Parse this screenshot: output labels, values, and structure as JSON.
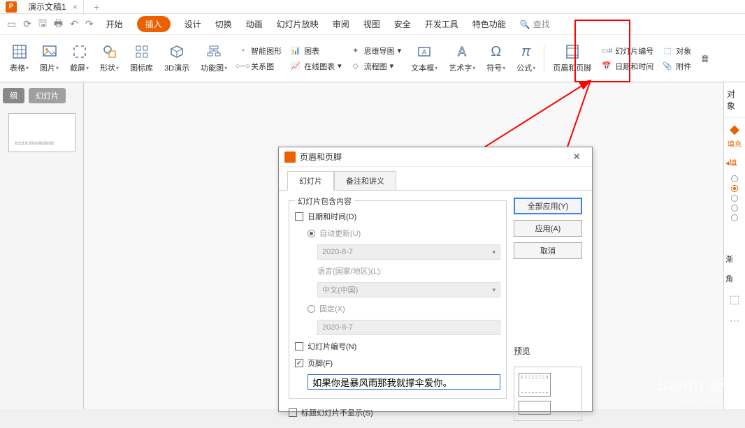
{
  "titlebar": {
    "app_name": "演示文稿1"
  },
  "qat": {
    "items": [
      "new",
      "open",
      "save",
      "print",
      "undo",
      "redo"
    ]
  },
  "menu": {
    "items": [
      "开始",
      "插入",
      "设计",
      "切换",
      "动画",
      "幻灯片放映",
      "审阅",
      "视图",
      "安全",
      "开发工具",
      "特色功能"
    ],
    "active": 1,
    "search": "查找"
  },
  "ribbon": {
    "big": [
      {
        "label": "表格",
        "icon": "table"
      },
      {
        "label": "图片",
        "icon": "picture"
      },
      {
        "label": "截屏",
        "icon": "screenshot"
      },
      {
        "label": "形状",
        "icon": "shapes"
      },
      {
        "label": "图标库",
        "icon": "iconlib"
      },
      {
        "label": "3D演示",
        "icon": "3d"
      },
      {
        "label": "功能图",
        "icon": "funcchart"
      }
    ],
    "col1": [
      {
        "label": "智能图形",
        "icon": "smartart"
      },
      {
        "label": "关系图",
        "icon": "relation"
      }
    ],
    "col2": [
      {
        "label": "图表",
        "icon": "chart"
      },
      {
        "label": "在线图表",
        "icon": "onlinechart"
      }
    ],
    "col3": [
      {
        "label": "思维导图",
        "icon": "mindmap"
      },
      {
        "label": "流程图",
        "icon": "flowchart"
      }
    ],
    "big2": [
      {
        "label": "文本框",
        "icon": "textbox"
      },
      {
        "label": "艺术字",
        "icon": "wordart"
      },
      {
        "label": "符号",
        "icon": "symbol"
      },
      {
        "label": "公式",
        "icon": "equation"
      },
      {
        "label": "页眉和页脚",
        "icon": "headerfooter"
      }
    ],
    "col4": [
      {
        "label": "幻灯片编号",
        "icon": "slidenum"
      },
      {
        "label": "日期和时间",
        "icon": "datetime"
      }
    ],
    "col5": [
      {
        "label": "对象",
        "icon": "object"
      },
      {
        "label": "附件",
        "icon": "attach"
      }
    ],
    "audio": "音"
  },
  "thumb": {
    "tabs": [
      "纲",
      "幻灯片"
    ],
    "active": 1,
    "content": "单击此处添加标题/副标题"
  },
  "sidepanel": {
    "title": "对象",
    "fill": "填充",
    "section": "填",
    "grad": "渐",
    "corner": "角"
  },
  "dialog": {
    "title": "页眉和页脚",
    "tabs": [
      "幻灯片",
      "备注和讲义"
    ],
    "active_tab": 0,
    "group_title": "幻灯片包含内容",
    "date_label": "日期和时间(D)",
    "auto_update": "自动更新(U)",
    "date_value": "2020-8-7",
    "lang_label": "语言(国家/地区)(L):",
    "lang_value": "中文(中国)",
    "fixed_label": "固定(X)",
    "fixed_value": "2020-8-7",
    "slidenum_label": "幻灯片编号(N)",
    "footer_label": "页脚(F)",
    "footer_value": "如果你是暴风雨那我就撑伞爱你。",
    "hide_title": "标题幻灯片不显示(S)",
    "btn_apply_all": "全部应用(Y)",
    "btn_apply": "应用(A)",
    "btn_cancel": "取消",
    "preview_label": "预览"
  },
  "watermark": {
    "logo": "Baidu 经验",
    "sub": "jingyan.baidu.com"
  }
}
